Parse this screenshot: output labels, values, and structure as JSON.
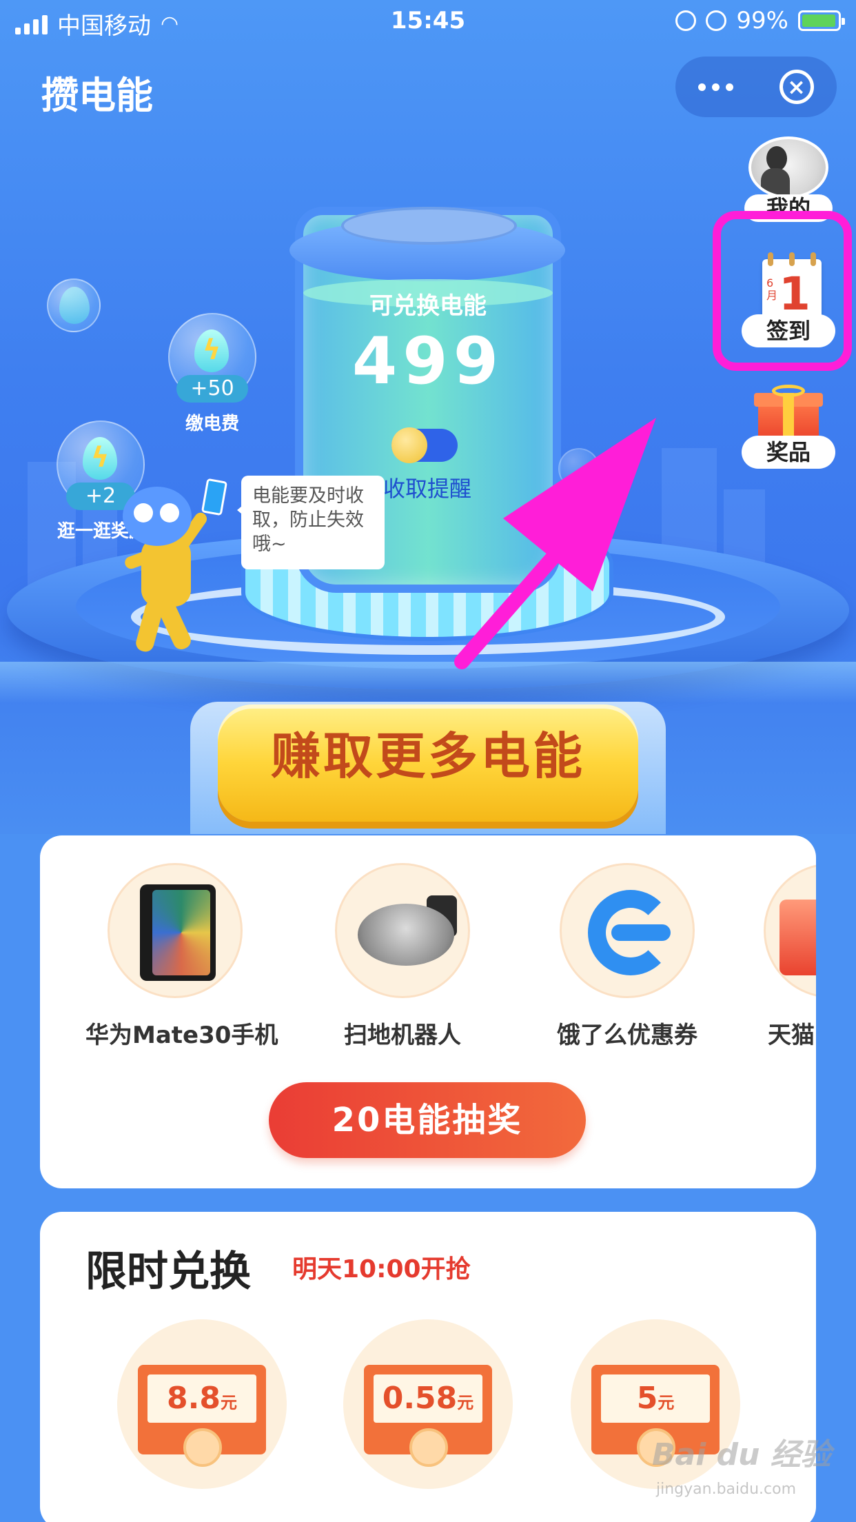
{
  "status_bar": {
    "carrier": "中国移动",
    "time": "15:45",
    "battery": "99%"
  },
  "nav": {
    "title": "攒电能",
    "more_icon": "more-dots-icon",
    "close_icon": "close-circle-icon"
  },
  "tank": {
    "label": "可兑换电能",
    "value": "499",
    "reminder_label": "收取提醒",
    "reminder_on": false
  },
  "bubbles": [
    {
      "amount": "+50",
      "caption": "缴电费"
    },
    {
      "amount": "+2",
      "caption": "逛一逛奖励"
    }
  ],
  "speech": "电能要及时收取，防止失效哦~",
  "side_menu": {
    "mine_label": "我的",
    "checkin_label": "签到",
    "checkin_date_month": "6月",
    "checkin_date_day": "1",
    "prize_label": "奖品"
  },
  "earn_button": "赚取更多电能",
  "prizes": {
    "items": [
      {
        "name": "华为Mate30手机",
        "icon": "phone-image"
      },
      {
        "name": "扫地机器人",
        "icon": "robot-vacuum-image"
      },
      {
        "name": "饿了么优惠券",
        "icon": "eleme-logo"
      },
      {
        "name": "天猫",
        "icon": "tmall-gift-image"
      }
    ],
    "draw_button": "20电能抽奖"
  },
  "limited": {
    "title": "限时兑换",
    "subtitle": "明天10:00开抢",
    "coupons": [
      {
        "amount": "8.8",
        "unit": "元"
      },
      {
        "amount": "0.58",
        "unit": "元"
      },
      {
        "amount": "5",
        "unit": "元"
      }
    ]
  },
  "watermark": {
    "main": "Bai du 经验",
    "sub": "jingyan.baidu.com"
  },
  "colors": {
    "hero_blue": "#4a90f0",
    "highlight": "#ff1ed8",
    "accent_red": "#e53a2e",
    "button_yellow": "#ffd53a"
  }
}
